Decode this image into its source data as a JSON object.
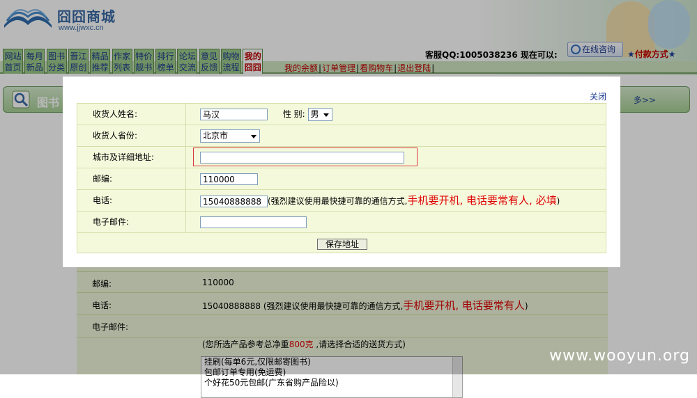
{
  "header": {
    "brand": "囧囧商城",
    "site": "www.jjwxc.cn",
    "qq_line": "客服QQ:1005038236  现在可以:",
    "consult_label": "在线咨询",
    "pay_label": "付款方式",
    "star": "★"
  },
  "nav": {
    "tabs": [
      {
        "line1": "网站",
        "line2": "首页"
      },
      {
        "line1": "每月",
        "line2": "新品"
      },
      {
        "line1": "图书",
        "line2": "分类"
      },
      {
        "line1": "晋江",
        "line2": "原创"
      },
      {
        "line1": "精品",
        "line2": "推荐"
      },
      {
        "line1": "作家",
        "line2": "列表"
      },
      {
        "line1": "特价",
        "line2": "靓书"
      },
      {
        "line1": "排行",
        "line2": "榜单"
      },
      {
        "line1": "论坛",
        "line2": "交流"
      },
      {
        "line1": "意见",
        "line2": "反馈"
      },
      {
        "line1": "购物",
        "line2": "流程"
      },
      {
        "line1": "我的",
        "line2": "囧囧"
      }
    ],
    "sub_links": [
      "我的余额",
      "订单管理",
      "看购物车",
      "退出登陆"
    ]
  },
  "search": {
    "label": "图书",
    "more": "多>>"
  },
  "background_form": {
    "postcode_label": "邮编:",
    "postcode_value": "110000",
    "phone_label": "电话:",
    "phone_value": "15040888888",
    "phone_note": "(强烈建议使用最快捷可靠的通信方式,",
    "phone_hot": "手机要开机, 电话要常有人",
    "phone_close": ")",
    "email_label": "电子邮件:",
    "weight_note_pre": "(您所选产品参考总净重",
    "weight_value": "800克",
    "weight_note_post": " ,请选择合适的送货方式)",
    "shipping_options": [
      "挂刷(每单6元,仅限邮寄图书)",
      "包邮订单专用(免运费)",
      "个好花50元包邮(广东省购产品险以)"
    ]
  },
  "modal": {
    "close_label": "关闭",
    "name_label": "收货人姓名:",
    "name_value": "马汉",
    "gender_label": "性 别:",
    "gender_value": "男",
    "province_label": "收货人省份:",
    "province_value": "北京市",
    "address_label": "城市及详细地址:",
    "address_value": "",
    "postcode_label": "邮编:",
    "postcode_value": "110000",
    "phone_label": "电话:",
    "phone_value": "15040888888",
    "phone_note": "(强烈建议使用最快捷可靠的通信方式,",
    "phone_hot": "手机要开机, 电话要常有人, 必填",
    "phone_close": ")",
    "email_label": "电子邮件:",
    "email_value": "",
    "save_label": "保存地址"
  },
  "watermark": "www.wooyun.org"
}
